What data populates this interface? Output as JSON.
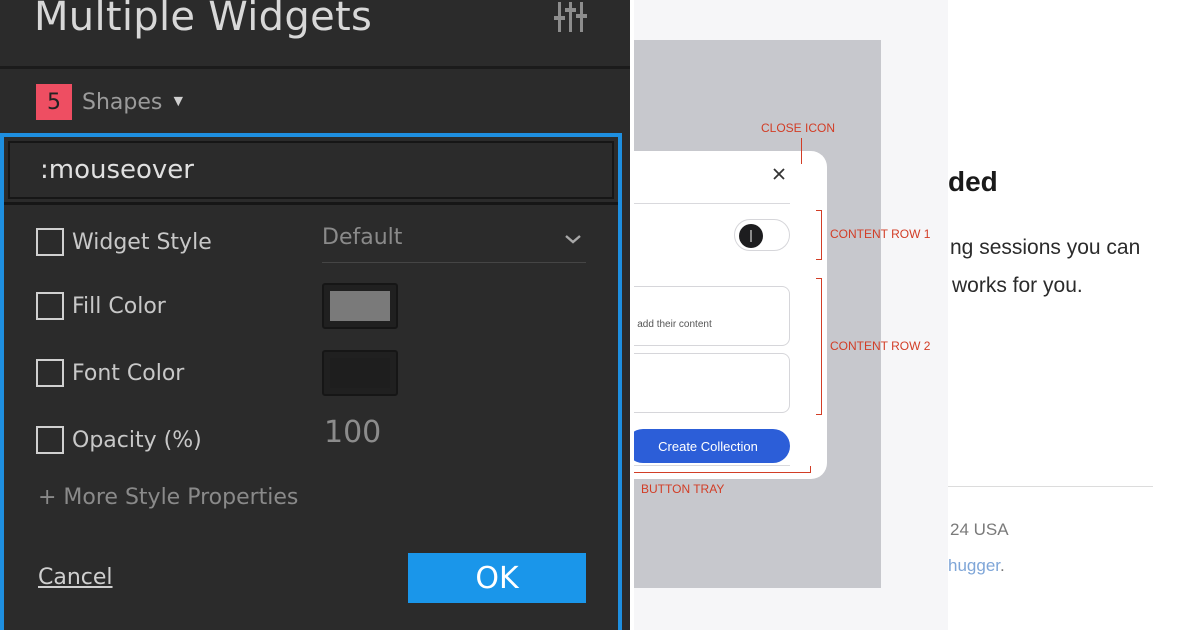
{
  "left_panel": {
    "title": "Multiple Widgets",
    "shapes_count": "5",
    "shapes_label": "Shapes",
    "dropdown_caret": "▼",
    "state": ":mouseover",
    "properties": [
      {
        "label": "Widget Style"
      },
      {
        "label": "Fill Color"
      },
      {
        "label": "Font Color"
      },
      {
        "label": "Opacity (%)"
      }
    ],
    "widget_style_value": "Default",
    "fill_color": "#7a7a7a",
    "font_color": "#1e1e1e",
    "opacity_value": "100",
    "more_link": "+ More Style Properties",
    "cancel_label": "Cancel",
    "ok_label": "OK",
    "accent_color": "#1a96ea",
    "badge_color": "#ee4e62",
    "icons": [
      "settings-sliders-icon",
      "chevron-down-icon"
    ]
  },
  "middle_panel": {
    "field_hint": "rs to add their content",
    "create_button": "Create Collection",
    "annotations": {
      "close_icon": "CLOSE ICON",
      "content_row_1": "CONTENT ROW 1",
      "content_row_2": "CONTENT ROW 2",
      "button_tray": "BUTTON TRAY"
    },
    "annotation_color": "#d23d26",
    "button_color": "#2c5ed8",
    "icons": [
      "close-icon"
    ]
  },
  "right_panel": {
    "heading": "ded",
    "body_line_1": "ng sessions you can",
    "body_line_2": "works for you.",
    "address": "24 USA",
    "link_text": "hugger",
    "link_suffix": "."
  }
}
